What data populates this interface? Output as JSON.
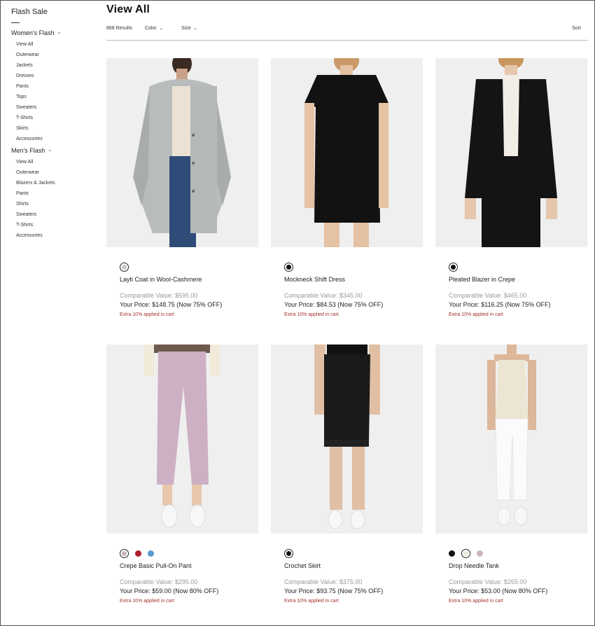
{
  "sidebar": {
    "title": "Flash Sale",
    "womens": {
      "label": "Women's Flash",
      "items": [
        "View All",
        "Outerwear",
        "Jackets",
        "Dresses",
        "Pants",
        "Tops",
        "Sweaters",
        "T-Shirts",
        "Skirts",
        "Accessories"
      ]
    },
    "mens": {
      "label": "Men's Flash",
      "items": [
        "View All",
        "Outerwear",
        "Blazers & Jackets",
        "Pants",
        "Shirts",
        "Sweaters",
        "T-Shirts",
        "Accessories"
      ]
    }
  },
  "header": {
    "title": "View All",
    "results": "868 Results",
    "color_label": "Color",
    "size_label": "Size",
    "sort_label": "Sort"
  },
  "icons": {
    "chevron": "chevron-down-icon",
    "swatch": "color-swatch"
  },
  "colors": {
    "extra_text": "#a3332a",
    "muted_text": "#999999",
    "image_bg": "#efefef"
  },
  "products": [
    {
      "name": "Layti Coat in Wool-Cashmere",
      "comparable": "Comparable Value: $595.00",
      "price": "Your Price: $148.75 (Now 75% OFF)",
      "extra": "Extra 10% applied in cart",
      "swatches": [
        "#c8c8c8"
      ]
    },
    {
      "name": "Mockneck Shift Dress",
      "comparable": "Comparable Value: $345.00",
      "price": "Your Price: $84.53 (Now 75% OFF)",
      "extra": "Extra 10% applied in cart",
      "swatches": [
        "#111111"
      ]
    },
    {
      "name": "Pleated Blazer in Crepe",
      "comparable": "Comparable Value: $465.00",
      "price": "Your Price: $116.25 (Now 75% OFF)",
      "extra": "Extra 10% applied in cart",
      "swatches": [
        "#111111"
      ]
    },
    {
      "name": "Crepe Basic Pull-On Pant",
      "comparable": "Comparable Value: $295.00",
      "price": "Your Price: $59.00 (Now 80% OFF)",
      "extra": "Extra 10% applied in cart",
      "swatches": [
        "#cfb3c4",
        "#b01e2e",
        "#5b9bd0"
      ]
    },
    {
      "name": "Crochet Skirt",
      "comparable": "Comparable Value: $375.00",
      "price": "Your Price: $93.75 (Now 75% OFF)",
      "extra": "Extra 10% applied in cart",
      "swatches": [
        "#111111"
      ]
    },
    {
      "name": "Drop Needle Tank",
      "comparable": "Comparable Value: $265.00",
      "price": "Your Price: $53.00 (Now 80% OFF)",
      "extra": "Extra 10% applied in cart",
      "swatches": [
        "#111111",
        "#ece8de",
        "#cfb3c4"
      ]
    }
  ]
}
